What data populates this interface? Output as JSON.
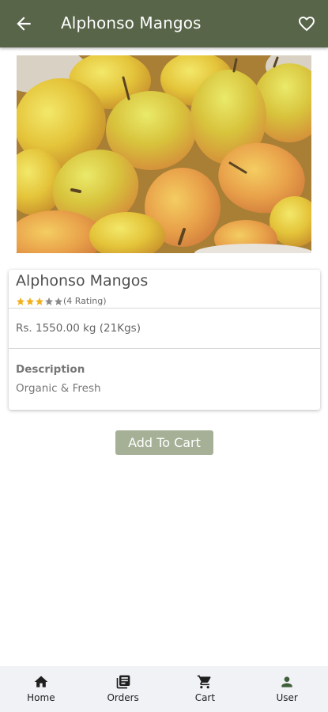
{
  "appbar": {
    "title": "Alphonso Mangos",
    "back_icon": "arrow-back-icon",
    "favorite_icon": "heart-outline-icon",
    "background": "#586549"
  },
  "product": {
    "name": "Alphonso Mangos",
    "rating_stars_filled": 3,
    "rating_stars_total": 5,
    "rating_text": "(4 Rating)",
    "price": "Rs. 1550.00 kg (21Kgs)",
    "description_label": "Description",
    "description": "Organic & Fresh",
    "star_color": "#f2b01e",
    "star_empty_color": "#8a8a8a"
  },
  "actions": {
    "add_to_cart": "Add To Cart",
    "button_color": "#a5b096"
  },
  "bottom_nav": {
    "items": [
      {
        "label": "Home",
        "icon": "home-icon"
      },
      {
        "label": "Orders",
        "icon": "orders-icon"
      },
      {
        "label": "Cart",
        "icon": "cart-icon"
      },
      {
        "label": "User",
        "icon": "user-icon"
      }
    ]
  }
}
